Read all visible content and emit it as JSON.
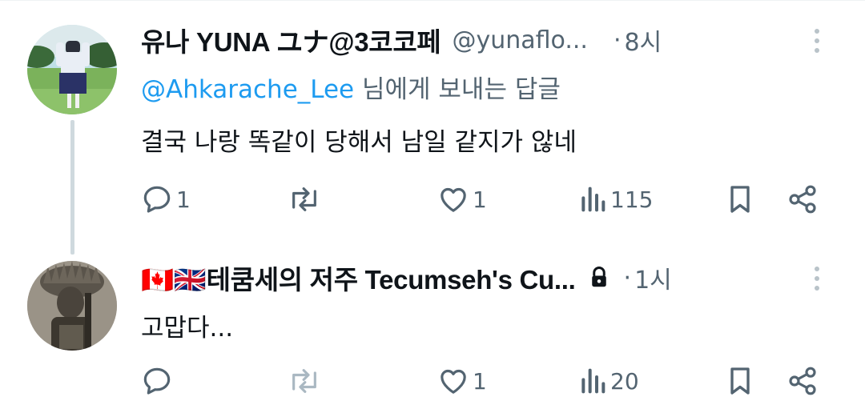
{
  "tweets": [
    {
      "author_name": "유나 YUNA ユナ@3코코페",
      "handle": "@yunaflo...",
      "separator": "·",
      "time": "8시",
      "reply_to": {
        "mention": "@Ahkarache_Lee",
        "suffix": " 님에게 보내는 답글"
      },
      "text": "결국 나랑 똑같이 당해서 남일 같지가 않네",
      "actions": {
        "replies": "1",
        "retweets": "",
        "likes": "1",
        "views": "115"
      }
    },
    {
      "author_name": "🇨🇦🇬🇧테쿰세의 저주 Tecumseh's Cu...",
      "locked": true,
      "separator": "·",
      "time": "1시",
      "text": "고맙다...",
      "actions": {
        "replies": "",
        "retweets": "",
        "likes": "1",
        "views": "20"
      }
    }
  ],
  "colors": {
    "accent": "#1d9bf0",
    "muted": "#536471",
    "thread_line": "#cfd9de"
  },
  "icons": [
    "reply-icon",
    "retweet-icon",
    "like-icon",
    "views-icon",
    "bookmark-icon",
    "share-icon",
    "more-icon",
    "lock-icon"
  ]
}
